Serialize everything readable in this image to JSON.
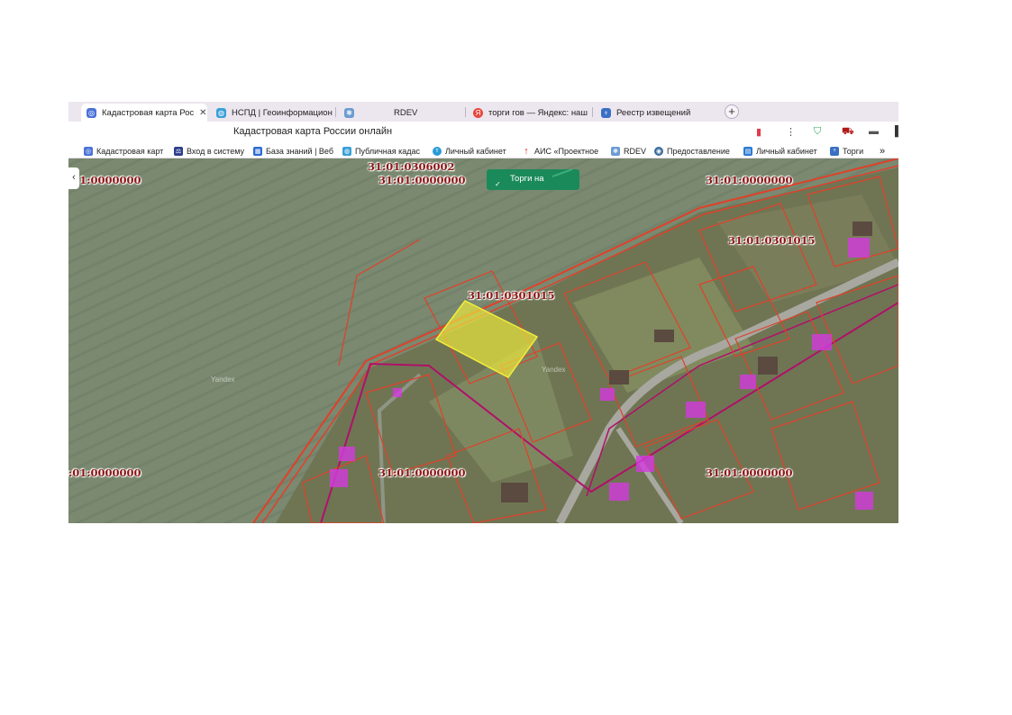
{
  "tabs": [
    {
      "label": "Кадастровая карта Рос",
      "close": "✕",
      "color": "#4a72d8",
      "glyph": "◎"
    },
    {
      "label": "НСПД | Геоинформацион",
      "color": "#3aa0d8",
      "glyph": "◍"
    },
    {
      "label": "RDEV",
      "color": "#6b9bd1",
      "glyph": "❃"
    },
    {
      "label": "торги гов — Яндекс: наш",
      "color": "#e8483c",
      "glyph": "Я"
    },
    {
      "label": "Реестр извещений",
      "color": "#3a6fc4",
      "glyph": "♆"
    }
  ],
  "new_tab": "+",
  "address": {
    "title": "Кадастровая карта России онлайн",
    "menu_glyph": "⋮"
  },
  "bookmarks": [
    {
      "label": "Кадастровая карт",
      "color": "#4a72d8",
      "glyph": "◎"
    },
    {
      "label": "Вход в систему",
      "color": "#2d3e8c",
      "glyph": "⚖"
    },
    {
      "label": "База знаний | Веб",
      "color": "#2a6bd1",
      "glyph": "▦"
    },
    {
      "label": "Публичная кадас",
      "color": "#3aa0d8",
      "glyph": "◍"
    },
    {
      "label": "Личный кабинет",
      "color": "#2a9ad8",
      "glyph": "т"
    },
    {
      "label": "АИС «Проектное",
      "color": "#e03030",
      "glyph": "↑"
    },
    {
      "label": "RDEV",
      "color": "#6b9bd1",
      "glyph": "❃"
    },
    {
      "label": "Предоставление",
      "color": "#3a6a9c",
      "glyph": "◉"
    },
    {
      "label": "Личный кабинет",
      "color": "#2a7ad1",
      "glyph": "▤"
    },
    {
      "label": "Торги",
      "color": "#3a6fc4",
      "glyph": "♆"
    }
  ],
  "bookmarks_more": "»",
  "map": {
    "collapse_glyph": "‹",
    "torgi_button": "Торги на",
    "torgi_check": "✓",
    "watermark": "Yandex",
    "labels": [
      "31:01:0306002",
      "31:01:0000000",
      ":1:0000000",
      "31:01:0000000",
      "31:01:0301015",
      "31:01:0301015",
      "31:01:0000000",
      ":01:0000000",
      "31:01:0000000"
    ]
  },
  "colors": {
    "parcel_border": "#e0402a",
    "boundary": "#b0106a",
    "highlight": "#f2ee3a",
    "building": "#d43ae0"
  }
}
